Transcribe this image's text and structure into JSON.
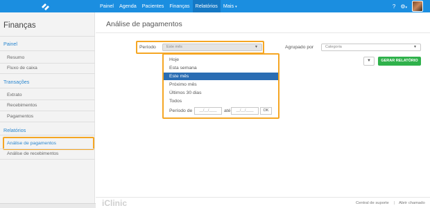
{
  "nav": {
    "items": [
      "Painel",
      "Agenda",
      "Pacientes",
      "Finanças",
      "Relatórios",
      "Mais"
    ],
    "active": "Relatórios",
    "more_caret": "▾"
  },
  "top_icons": {
    "help": "?",
    "settings": "⚙",
    "settings_caret": "▾"
  },
  "sidebar": {
    "title": "Finanças",
    "painel": {
      "heading": "Painel",
      "items": [
        "Resumo",
        "Fluxo de caixa"
      ]
    },
    "transacoes": {
      "heading": "Transações",
      "items": [
        "Extrato",
        "Recebimentos",
        "Pagamentos"
      ]
    },
    "relatorios": {
      "heading": "Relatórios",
      "items": [
        "Análise de pagamentos",
        "Análise de recebimentos"
      ]
    }
  },
  "main": {
    "title": "Análise de pagamentos",
    "periodo_label": "Período",
    "periodo_value": "Este mês",
    "agrupado_label": "Agrupado por",
    "agrupado_placeholder": "Categoria",
    "gerar_label": "GERAR RELATÓRIO",
    "filter_icon": "▼"
  },
  "dropdown": {
    "options": [
      "Hoje",
      "Esta semana",
      "Este mês",
      "Próximo mês",
      "Últimos 30 dias",
      "Todos"
    ],
    "selected_index": 2,
    "periodo_de_label": "Período de",
    "ate_label": "até",
    "date_placeholder": "__/__/____",
    "ok_label": "OK"
  },
  "footer": {
    "logo": "iClinic",
    "central": "Central de suporte",
    "divider": "|",
    "chamado": "Abrir chamado"
  },
  "colors": {
    "nav_bg": "#1b8ee0",
    "accent": "#2a86cf",
    "highlight": "#f5a623",
    "button_green": "#2fb14b",
    "selected_bg": "#2a6db3"
  }
}
